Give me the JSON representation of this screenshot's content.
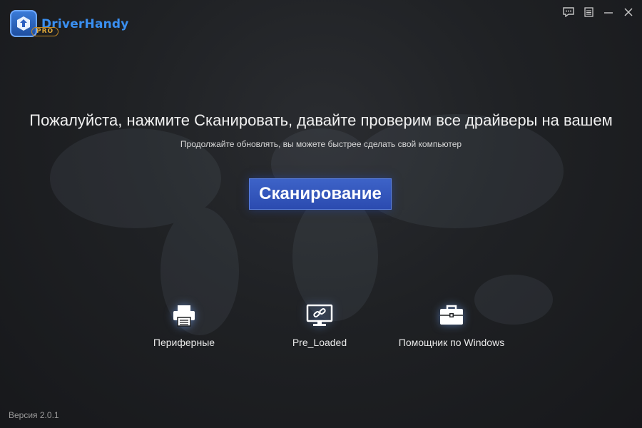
{
  "app": {
    "logo_text": "DriverHandy",
    "logo_badge": "PRO"
  },
  "controls": {
    "feedback_icon": "chat-icon",
    "menu_icon": "menu-icon",
    "minimize_icon": "minimize-icon",
    "close_icon": "close-icon"
  },
  "main": {
    "headline": "Пожалуйста, нажмите Сканировать, давайте проверим все драйверы на вашем",
    "subline": "Продолжайте обновлять, вы можете быстрее сделать свой компьютер",
    "scan_button": "Сканирование"
  },
  "tools": [
    {
      "label": "Периферные",
      "icon": "printer-icon"
    },
    {
      "label": "Pre_Loaded",
      "icon": "monitor-link-icon"
    },
    {
      "label": "Помощник по Windows",
      "icon": "toolbox-icon"
    }
  ],
  "footer": {
    "version": "Версия 2.0.1"
  },
  "colors": {
    "accent": "#3d63c8",
    "logo_blue": "#3a8ff0",
    "badge_gold": "#e0a93a",
    "background": "#1f2124"
  }
}
